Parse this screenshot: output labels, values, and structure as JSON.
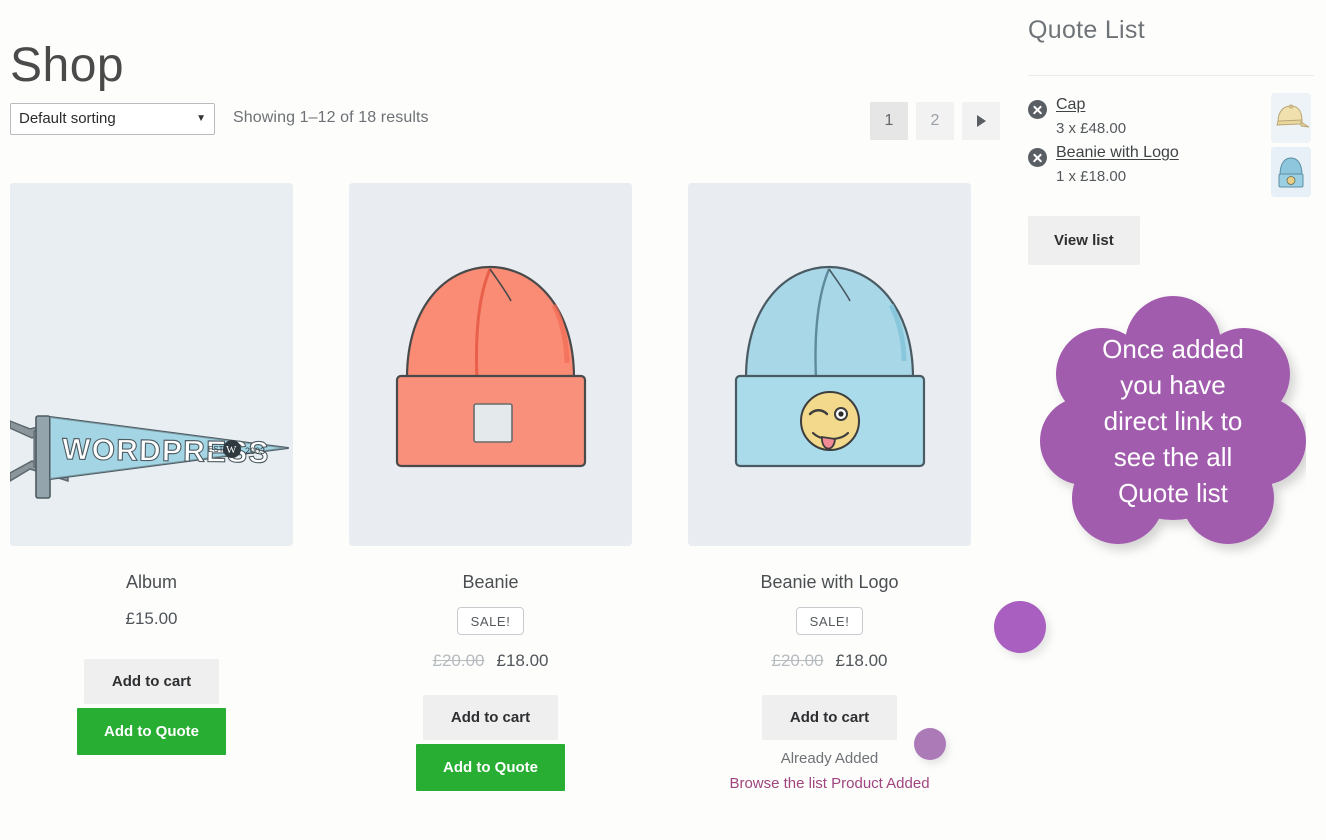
{
  "page": {
    "title": "Shop"
  },
  "toolbar": {
    "sort": {
      "selected": "Default sorting",
      "caret_icon": "chevron-down-icon",
      "options": [
        "Default sorting"
      ]
    },
    "result_count": "Showing 1–12 of 18 results",
    "pagination": {
      "pages": [
        "1",
        "2"
      ],
      "current": "1",
      "next_icon": "triangle-right-icon"
    }
  },
  "products": [
    {
      "name": "Album",
      "image_alt": "wordpress-pennant-image",
      "on_sale": false,
      "sale_label": "",
      "price": "£15.00",
      "regular_price": "",
      "add_to_cart_label": "Add to cart",
      "quote_label": "Add to Quote",
      "quote_state": "add",
      "already_added_label": "",
      "browse_link_label": ""
    },
    {
      "name": "Beanie",
      "image_alt": "pink-beanie-image",
      "on_sale": true,
      "sale_label": "SALE!",
      "price": "£18.00",
      "regular_price": "£20.00",
      "add_to_cart_label": "Add to cart",
      "quote_label": "Add to Quote",
      "quote_state": "add",
      "already_added_label": "",
      "browse_link_label": ""
    },
    {
      "name": "Beanie with Logo",
      "image_alt": "blue-beanie-with-logo-image",
      "on_sale": true,
      "sale_label": "SALE!",
      "price": "£18.00",
      "regular_price": "£20.00",
      "add_to_cart_label": "Add to cart",
      "quote_label": "",
      "quote_state": "added",
      "already_added_label": "Already Added",
      "browse_link_label": "Browse the list Product Added"
    }
  ],
  "sidebar": {
    "title": "Quote List",
    "items": [
      {
        "name": "Cap",
        "quantity_price": "3 x £48.00",
        "remove_icon": "remove-circle-x-icon",
        "thumb_alt": "cap-thumbnail"
      },
      {
        "name": "Beanie with Logo",
        "quantity_price": "1 x £18.00",
        "remove_icon": "remove-circle-x-icon",
        "thumb_alt": "beanie-with-logo-thumbnail"
      }
    ],
    "view_list_label": "View list"
  },
  "callout": {
    "lines": [
      "Once added",
      "you have",
      "direct link to",
      "see the all",
      "Quote list"
    ],
    "color": "#a15bad"
  },
  "colors": {
    "quote_button": "#27ae33",
    "accent_purple": "#a85fc0",
    "link_pink": "#a0457f",
    "thumb_bg": "#e9eef2"
  }
}
